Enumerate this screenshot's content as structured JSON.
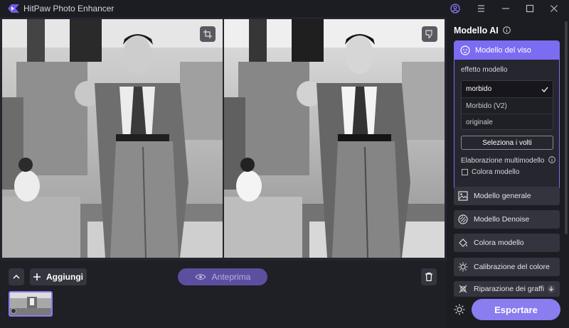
{
  "window": {
    "title": "HitPaw Photo Enhancer"
  },
  "toolbar": {
    "add_label": "Aggiungi",
    "preview_label": "Anteprima"
  },
  "sidebar": {
    "title": "Modello AI",
    "face_model": {
      "label": "Modello del viso",
      "effect_label": "effetto modello",
      "options": [
        {
          "label": "morbido",
          "selected": true
        },
        {
          "label": "Morbido (V2)",
          "selected": false
        },
        {
          "label": "originale",
          "selected": false
        }
      ],
      "select_faces_label": "Seleziona i volti",
      "multimodel_label": "Elaborazione multimodello",
      "color_model_checkbox": "Colora modello",
      "color_model_checked": false
    },
    "models": [
      {
        "label": "Modello generale",
        "icon": "image-icon"
      },
      {
        "label": "Modello Denoise",
        "icon": "denoise-icon"
      },
      {
        "label": "Colora modello",
        "icon": "paint-bucket-icon"
      },
      {
        "label": "Calibrazione del colore",
        "icon": "sun-icon"
      },
      {
        "label": "Riparazione dei graffi",
        "icon": "scratch-repair-icon"
      }
    ],
    "export_label": "Esportare"
  },
  "colors": {
    "accent": "#7c6cf2",
    "background": "#1c1c23",
    "panel": "#25252d"
  }
}
